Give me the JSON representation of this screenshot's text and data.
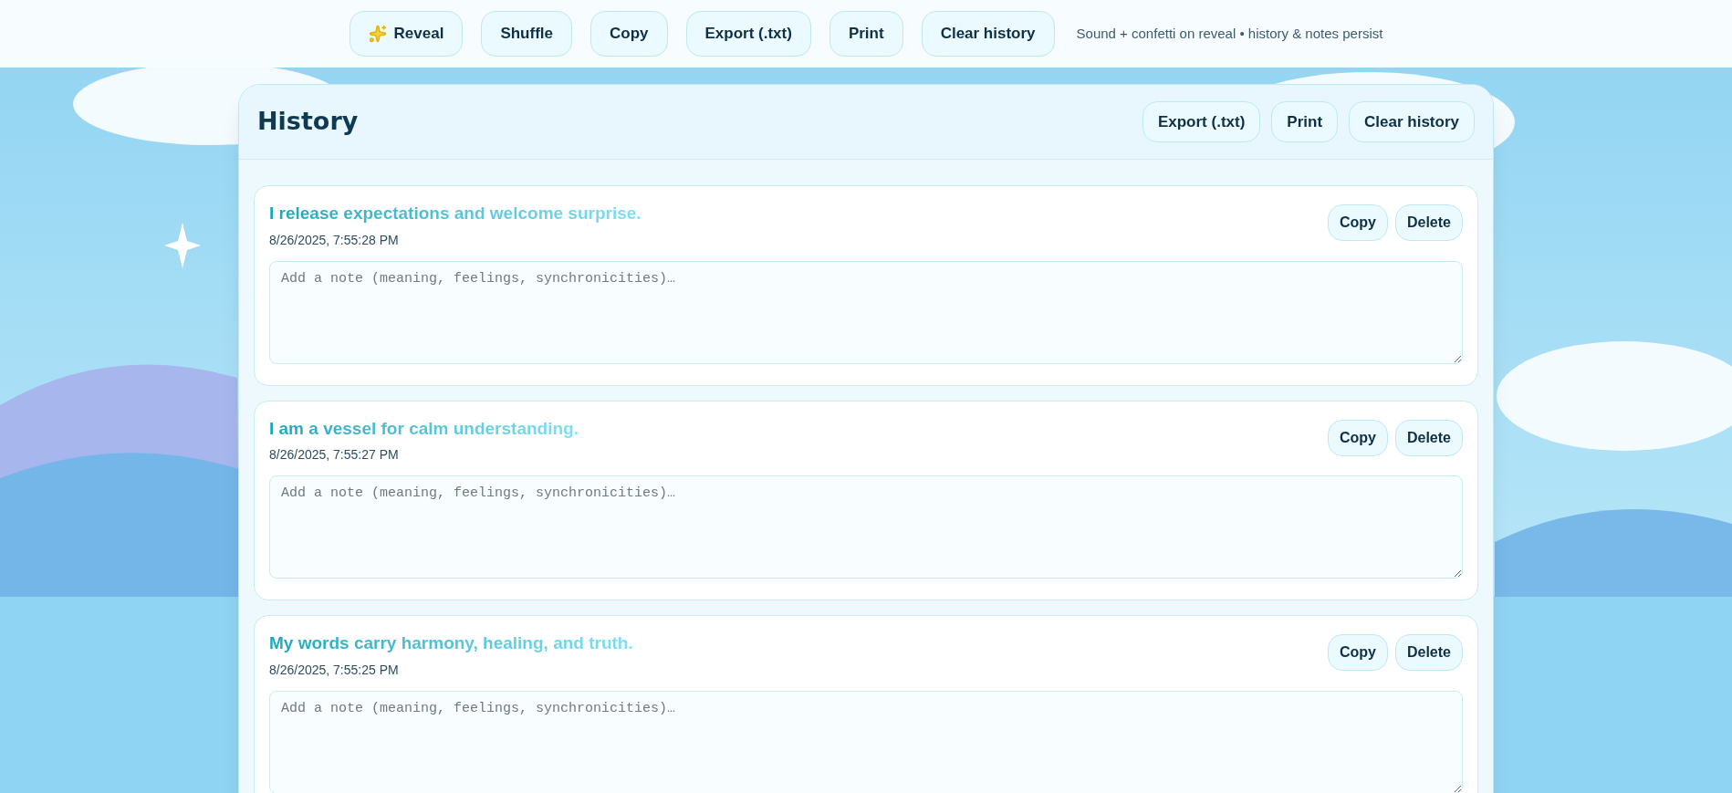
{
  "toolbar": {
    "buttons": [
      {
        "label": "Reveal",
        "kind": "sparkle"
      },
      {
        "label": "Shuffle",
        "kind": "plain"
      },
      {
        "label": "Copy",
        "kind": "plain"
      },
      {
        "label": "Export (.txt)",
        "kind": "plain"
      },
      {
        "label": "Print",
        "kind": "plain"
      },
      {
        "label": "Clear history",
        "kind": "plain"
      }
    ],
    "note": "Sound + confetti on reveal • history & notes persist"
  },
  "history": {
    "title": "History",
    "buttons": [
      "Export (.txt)",
      "Print",
      "Clear history"
    ],
    "entries": [
      {
        "text": "I release expectations and welcome surprise.",
        "timestamp": "8/26/2025, 7:55:28 PM",
        "note": {
          "placeholder": "Add a note (meaning, feelings, synchronicities)…"
        },
        "buttons": [
          "Copy",
          "Delete"
        ]
      },
      {
        "text": "I am a vessel for calm understanding.",
        "timestamp": "8/26/2025, 7:55:27 PM",
        "note": {
          "placeholder": "Add a note (meaning, feelings, synchronicities)…"
        },
        "buttons": [
          "Copy",
          "Delete"
        ]
      },
      {
        "text": "My words carry harmony, healing, and truth.",
        "timestamp": "8/26/2025, 7:55:25 PM",
        "note": {
          "placeholder": "Add a note (meaning, feelings, synchronicities)…"
        },
        "buttons": [
          "Copy",
          "Delete"
        ]
      }
    ]
  }
}
